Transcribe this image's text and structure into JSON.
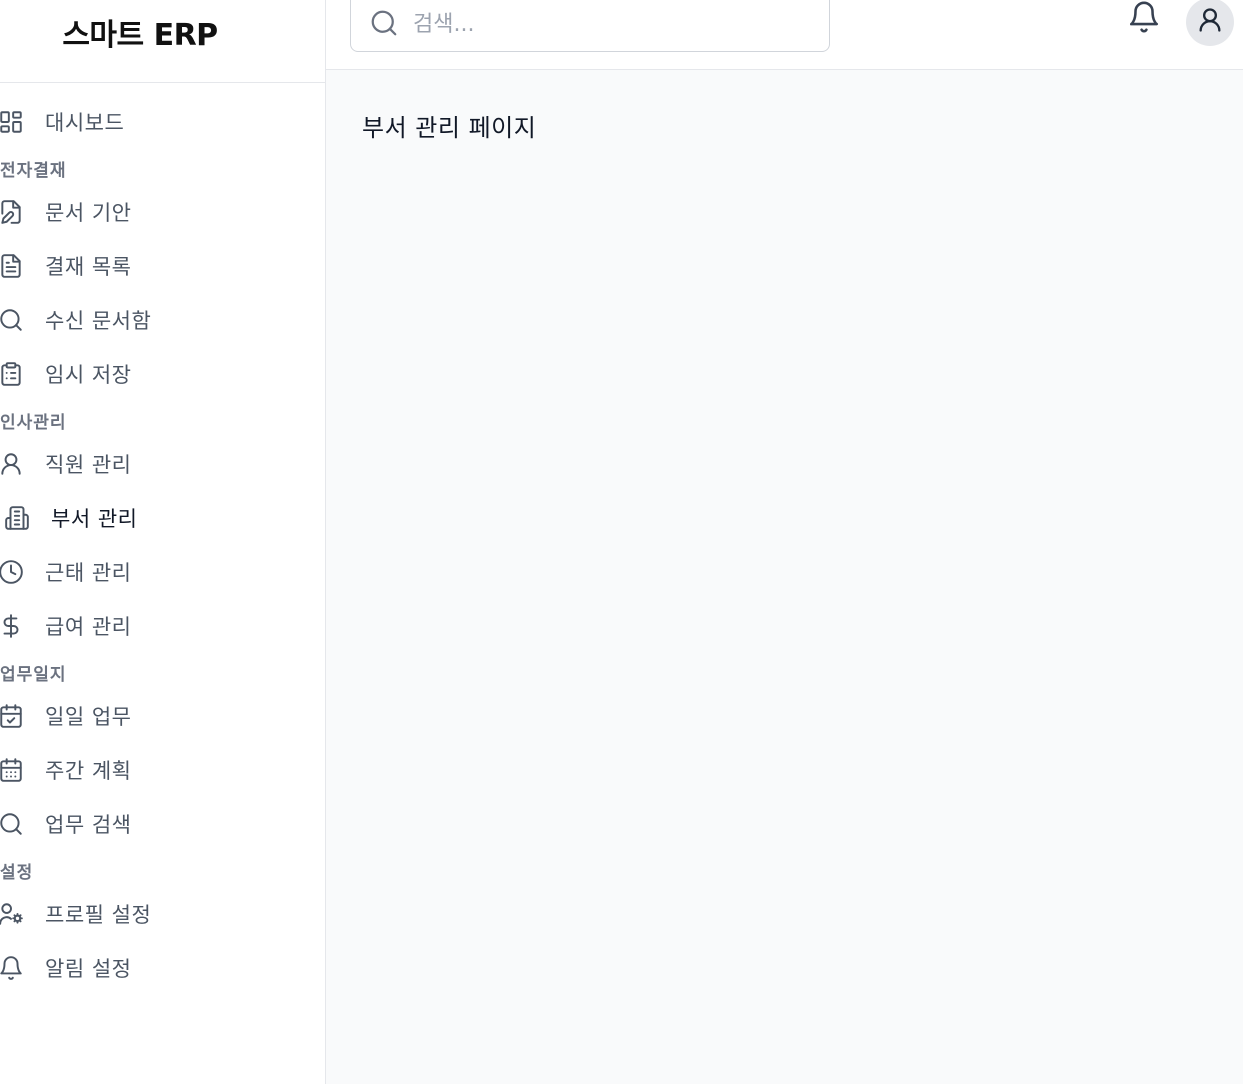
{
  "brand": {
    "title": "스마트 ERP"
  },
  "search": {
    "placeholder": "검색..."
  },
  "sidebar": {
    "dashboard": {
      "label": "대시보드",
      "icon": "dashboard-grid-icon"
    },
    "sections": [
      {
        "title": "전자결재",
        "items": [
          {
            "label": "문서 기안",
            "icon": "file-edit-icon"
          },
          {
            "label": "결재 목록",
            "icon": "file-text-icon"
          },
          {
            "label": "수신 문서함",
            "icon": "search-icon"
          },
          {
            "label": "임시 저장",
            "icon": "clipboard-list-icon"
          }
        ]
      },
      {
        "title": "인사관리",
        "items": [
          {
            "label": "직원 관리",
            "icon": "user-icon"
          },
          {
            "label": "부서 관리",
            "icon": "building-icon",
            "active": true
          },
          {
            "label": "근태 관리",
            "icon": "clock-icon"
          },
          {
            "label": "급여 관리",
            "icon": "dollar-icon"
          }
        ]
      },
      {
        "title": "업무일지",
        "items": [
          {
            "label": "일일 업무",
            "icon": "calendar-check-icon"
          },
          {
            "label": "주간 계획",
            "icon": "calendar-days-icon"
          },
          {
            "label": "업무 검색",
            "icon": "search-icon"
          }
        ]
      },
      {
        "title": "설정",
        "items": [
          {
            "label": "프로필 설정",
            "icon": "user-cog-icon"
          },
          {
            "label": "알림 설정",
            "icon": "bell-icon"
          }
        ]
      }
    ]
  },
  "topbar": {
    "notification_icon": "bell-icon",
    "avatar_icon": "user-icon"
  },
  "main": {
    "page_text": "부서 관리 페이지"
  },
  "colors": {
    "sidebar_bg": "#ffffff",
    "main_bg": "#f9fafb",
    "border": "#e5e7eb",
    "nav_text": "#4b5563",
    "section_text": "#6b7280",
    "active_text": "#111827"
  }
}
